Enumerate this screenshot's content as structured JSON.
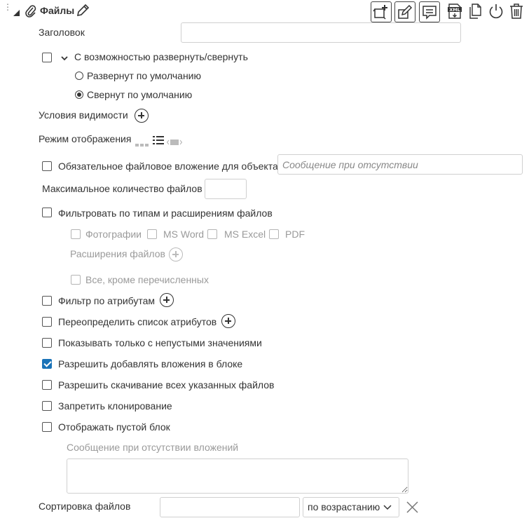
{
  "header": {
    "title": "Файлы",
    "icons": [
      "drag-handle-icon",
      "collapse-triangle-icon",
      "paperclip-icon",
      "edit-pencil-icon"
    ],
    "toolbar": [
      "add-block-icon",
      "edit-block-icon",
      "comment-icon",
      "xml-export-icon",
      "copy-icon",
      "power-icon",
      "trash-icon"
    ],
    "xml_label": "XML"
  },
  "title_field": {
    "label": "Заголовок",
    "value": ""
  },
  "expand": {
    "label": "С возможностью развернуть/свернуть",
    "checked": false,
    "options": [
      {
        "label": "Развернут по умолчанию",
        "selected": false
      },
      {
        "label": "Свернут по умолчанию",
        "selected": true
      }
    ]
  },
  "visibility": {
    "label": "Условия видимости"
  },
  "display_mode": {
    "label": "Режим отображения"
  },
  "mandatory": {
    "label": "Обязательное файловое вложение для объекта",
    "checked": false,
    "placeholder": "Сообщение при отсутствии"
  },
  "max_files": {
    "label": "Максимальное количество файлов",
    "value": ""
  },
  "filter_types": {
    "label": "Фильтровать по типам и расширениям файлов",
    "checked": false,
    "types": [
      "Фотографии",
      "MS Word",
      "MS Excel",
      "PDF"
    ],
    "extensions_label": "Расширения файлов",
    "except_label": "Все, кроме перечисленных"
  },
  "options": [
    {
      "label": "Фильтр по атрибутам",
      "checked": false
    },
    {
      "label": "Переопределить список атрибутов",
      "checked": false
    },
    {
      "label": "Показывать только с непустыми значениями",
      "checked": false
    },
    {
      "label": "Разрешить добавлять вложения в блоке",
      "checked": true
    },
    {
      "label": "Разрешить скачивание всех указанных файлов",
      "checked": false
    },
    {
      "label": "Запретить клонирование",
      "checked": false
    },
    {
      "label": "Отображать пустой блок",
      "checked": false
    }
  ],
  "empty_message": {
    "label": "Сообщение при отсутствии вложений",
    "value": ""
  },
  "sort": {
    "label": "Сортировка файлов",
    "value": "",
    "order": "по возрастанию"
  },
  "colors": {
    "accent": "#1a73b8",
    "border": "#d0d0d0",
    "muted": "#9a9a9a"
  }
}
